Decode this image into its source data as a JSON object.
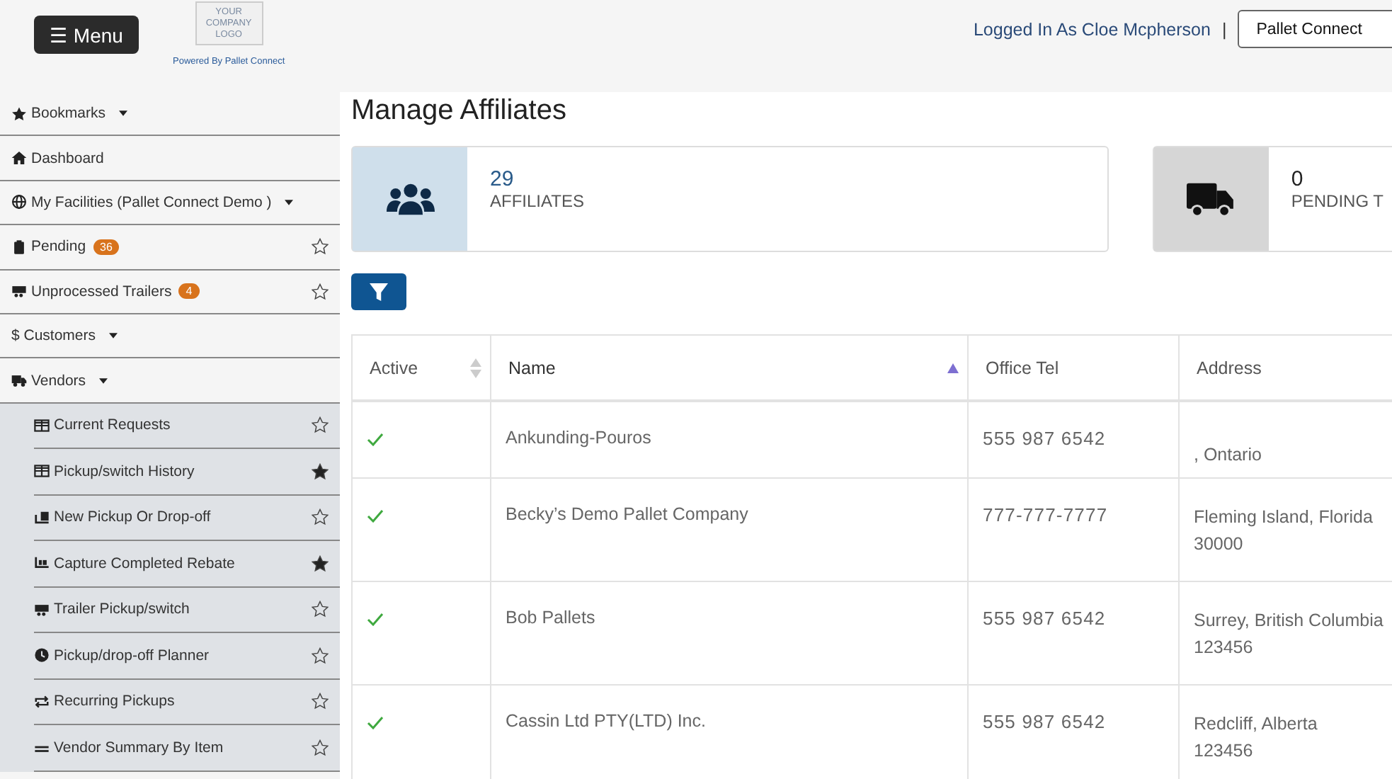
{
  "header": {
    "menu_button": "☰ Menu",
    "logo_lines": [
      "YOUR",
      "COMPANY",
      "LOGO"
    ],
    "powered_by": "Powered By Pallet Connect",
    "logged_in": "Logged In As Cloe Mcpherson",
    "separator": "|",
    "account_button": "Pallet Connect"
  },
  "sidebar": {
    "items": [
      {
        "label": "Bookmarks",
        "kind": "dropdown",
        "selected": false
      },
      {
        "label": "Dashboard",
        "kind": "link",
        "selected": false
      },
      {
        "label": "My Facilities  (Pallet Connect Demo )",
        "kind": "dropdown",
        "selected": false
      },
      {
        "label": "Pending",
        "badge": "36",
        "kind": "bookmarkable",
        "starred": false,
        "selected": false
      },
      {
        "label": "Unprocessed Trailers",
        "badge": "4",
        "kind": "bookmarkable",
        "starred": false,
        "selected": false
      },
      {
        "label": "$ Customers",
        "kind": "dropdown",
        "selected": false
      },
      {
        "label": "Vendors",
        "kind": "dropdown",
        "selected": false,
        "children": [
          {
            "label": "Current Requests",
            "starred": false
          },
          {
            "label": "Pickup/switch History",
            "starred": true
          },
          {
            "label": "New Pickup Or Drop-off",
            "starred": false
          },
          {
            "label": "Capture Completed Rebate",
            "starred": true
          },
          {
            "label": "Trailer Pickup/switch",
            "starred": false
          },
          {
            "label": "Pickup/drop-off Planner",
            "starred": false
          },
          {
            "label": "Recurring Pickups",
            "starred": false
          },
          {
            "label": "Vendor Summary By Item",
            "starred": false
          }
        ]
      }
    ]
  },
  "page": {
    "title": "Manage Affiliates",
    "stats": [
      {
        "value": "29",
        "label": "AFFILIATES",
        "color": "#cfdfeb"
      },
      {
        "value": "0",
        "label": "PENDING T",
        "color": "#d6d6d6"
      }
    ],
    "table": {
      "columns": [
        {
          "label": "Active",
          "sortable": true,
          "selected": false
        },
        {
          "label": "Name",
          "selected": true
        },
        {
          "label": "Office Tel",
          "selected": false
        },
        {
          "label": "Address",
          "selected": false
        }
      ],
      "rows": [
        {
          "active": true,
          "name": "Ankunding-Pouros",
          "office_tel": "555 987 6542",
          "address": [
            ", Ontario"
          ]
        },
        {
          "active": true,
          "name": "Becky’s Demo Pallet Company",
          "office_tel": "777-777-7777",
          "address": [
            "Fleming Island, Florida",
            "30000"
          ]
        },
        {
          "active": true,
          "name": "Bob Pallets",
          "office_tel": "555 987 6542",
          "address": [
            "Surrey, British Columbia",
            "123456"
          ]
        },
        {
          "active": true,
          "name": "Cassin Ltd PTY(LTD) Inc.",
          "office_tel": "555 987 6542",
          "address": [
            "Redcliff, Alberta",
            "123456"
          ]
        }
      ]
    }
  }
}
